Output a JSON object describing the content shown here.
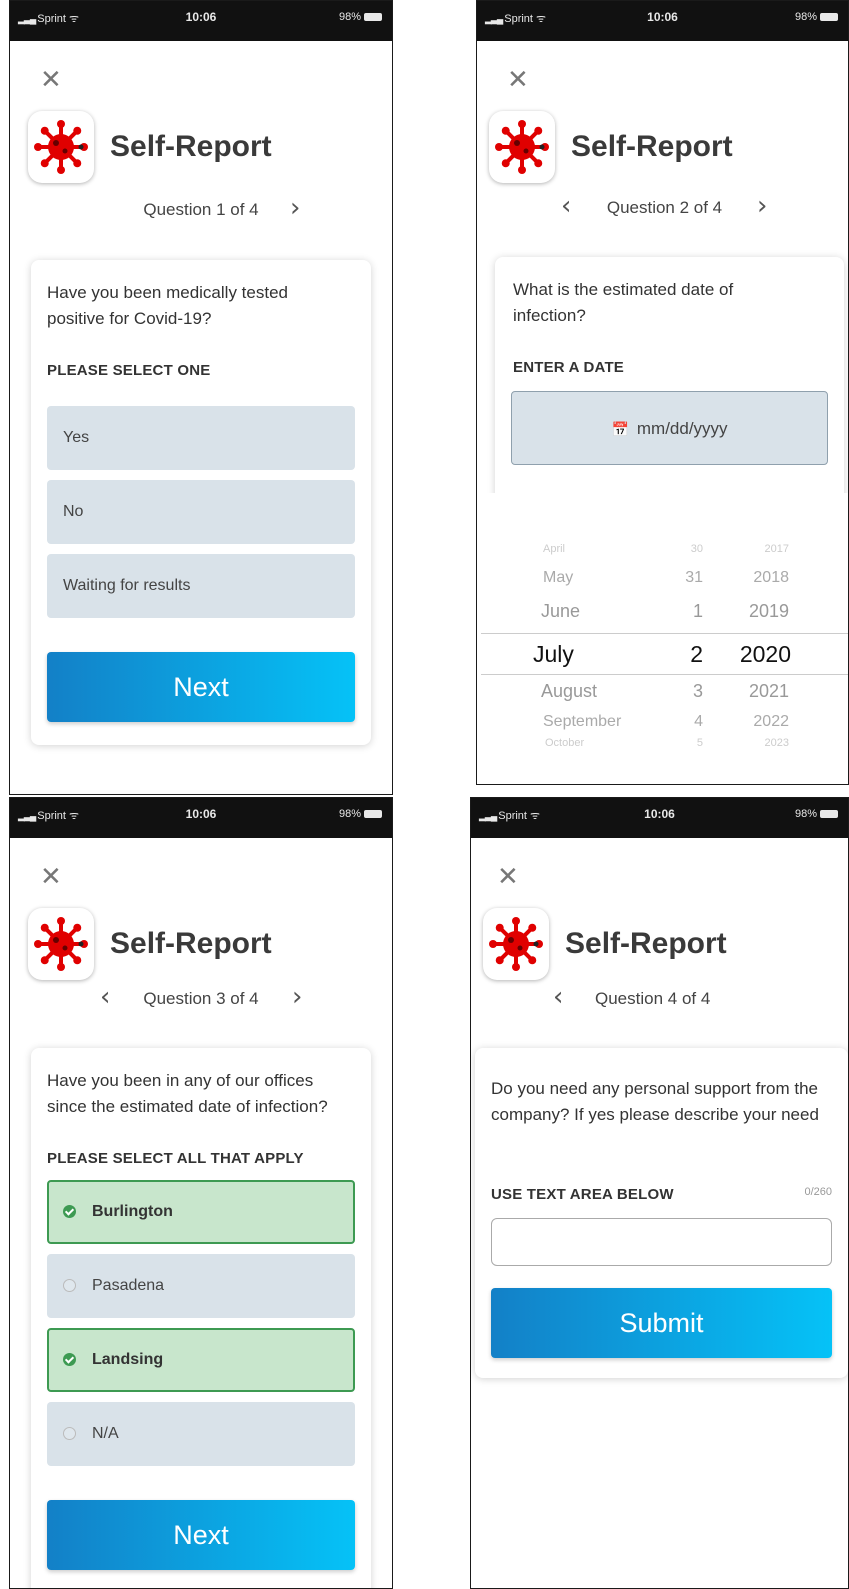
{
  "status_bar": {
    "carrier": "Sprint",
    "time": "10:06",
    "battery": "98%"
  },
  "app_title": "Self-Report",
  "colors": {
    "accent_start": "#1380c7",
    "accent_end": "#05c2f7",
    "option_bg": "#d9e2e9",
    "selected_bg": "#c8e6cc",
    "selected_border": "#3d9a52",
    "logo_red": "#e00000"
  },
  "screens": [
    {
      "nav_label": "Question 1 of 4",
      "question": "Have you been medically tested positive for Covid-19?",
      "instruction": "PLEASE SELECT ONE",
      "options": [
        "Yes",
        "No",
        "Waiting for results"
      ],
      "button": "Next"
    },
    {
      "nav_label": "Question 2 of 4",
      "question": "What is the estimated date of infection?",
      "instruction": "ENTER A DATE",
      "date_placeholder": "mm/dd/yyyy",
      "picker": {
        "months": [
          "April",
          "May",
          "June",
          "July",
          "August",
          "September",
          "October"
        ],
        "days": [
          "30",
          "31",
          "1",
          "2",
          "3",
          "4",
          "5"
        ],
        "years": [
          "2017",
          "2018",
          "2019",
          "2020",
          "2021",
          "2022",
          "2023"
        ],
        "selected": {
          "month": "July",
          "day": "2",
          "year": "2020"
        }
      }
    },
    {
      "nav_label": "Question 3 of 4",
      "question": "Have you been in any of our offices since the estimated date of infection?",
      "instruction": "PLEASE SELECT ALL THAT APPLY",
      "options": [
        {
          "label": "Burlington",
          "selected": true
        },
        {
          "label": "Pasadena",
          "selected": false
        },
        {
          "label": "Landsing",
          "selected": true
        },
        {
          "label": "N/A",
          "selected": false
        }
      ],
      "button": "Next"
    },
    {
      "nav_label": "Question 4 of 4",
      "question": "Do you need any personal support from the company? If yes please describe your need",
      "instruction": "USE TEXT AREA BELOW",
      "counter": "0/260",
      "textarea_value": "",
      "button": "Submit"
    }
  ]
}
